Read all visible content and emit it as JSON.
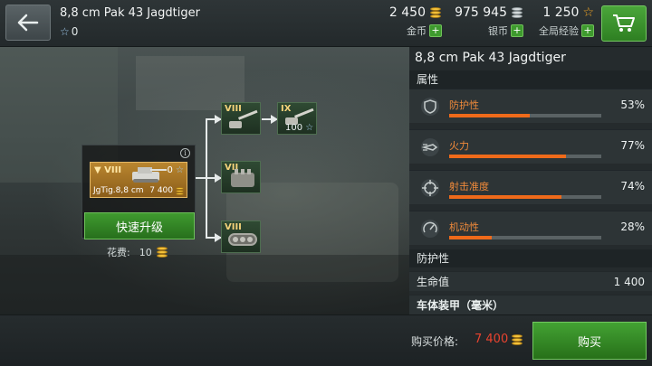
{
  "header": {
    "title": "8,8 cm Pak 43 Jagdtiger",
    "stars_value": "0",
    "gold": {
      "amount": "2 450",
      "label": "金币"
    },
    "silver": {
      "amount": "975 945",
      "label": "银币"
    },
    "global_xp": {
      "amount": "1 250",
      "label": "全局经验"
    }
  },
  "tree": {
    "current": {
      "tier": "VIII",
      "xp": "0",
      "name": "JgTig.8,8 cm",
      "price": "7 400"
    },
    "quick_upgrade_label": "快速升级",
    "cost_label": "花费:",
    "cost_value": "10",
    "modules": [
      {
        "tier": "VIII",
        "type": "gun"
      },
      {
        "tier": "IX",
        "type": "gun",
        "xp": "100"
      },
      {
        "tier": "VII",
        "type": "engine"
      },
      {
        "tier": "VIII",
        "type": "tracks"
      }
    ]
  },
  "panel": {
    "title": "8,8 cm Pak 43 Jagdtiger",
    "attributes_header": "属性",
    "stats": [
      {
        "label": "防护性",
        "value": "53%",
        "fill": 0.53,
        "icon": "shield-icon"
      },
      {
        "label": "火力",
        "value": "77%",
        "fill": 0.77,
        "icon": "shell-icon"
      },
      {
        "label": "射击准度",
        "value": "74%",
        "fill": 0.74,
        "icon": "crosshair-icon"
      },
      {
        "label": "机动性",
        "value": "28%",
        "fill": 0.28,
        "icon": "speedometer-icon"
      }
    ],
    "protection_header": "防护性",
    "hp_label": "生命值",
    "hp_value": "1 400",
    "hull_armor_label": "车体装甲（毫米）"
  },
  "footer": {
    "price_label": "购买价格:",
    "price_value": "7 400",
    "buy_label": "购买"
  },
  "colors": {
    "accent_green": "#3f9a2f",
    "stat_bar": "#ef6a1a",
    "price_red": "#e8432f",
    "gold": "#f5c33a"
  }
}
